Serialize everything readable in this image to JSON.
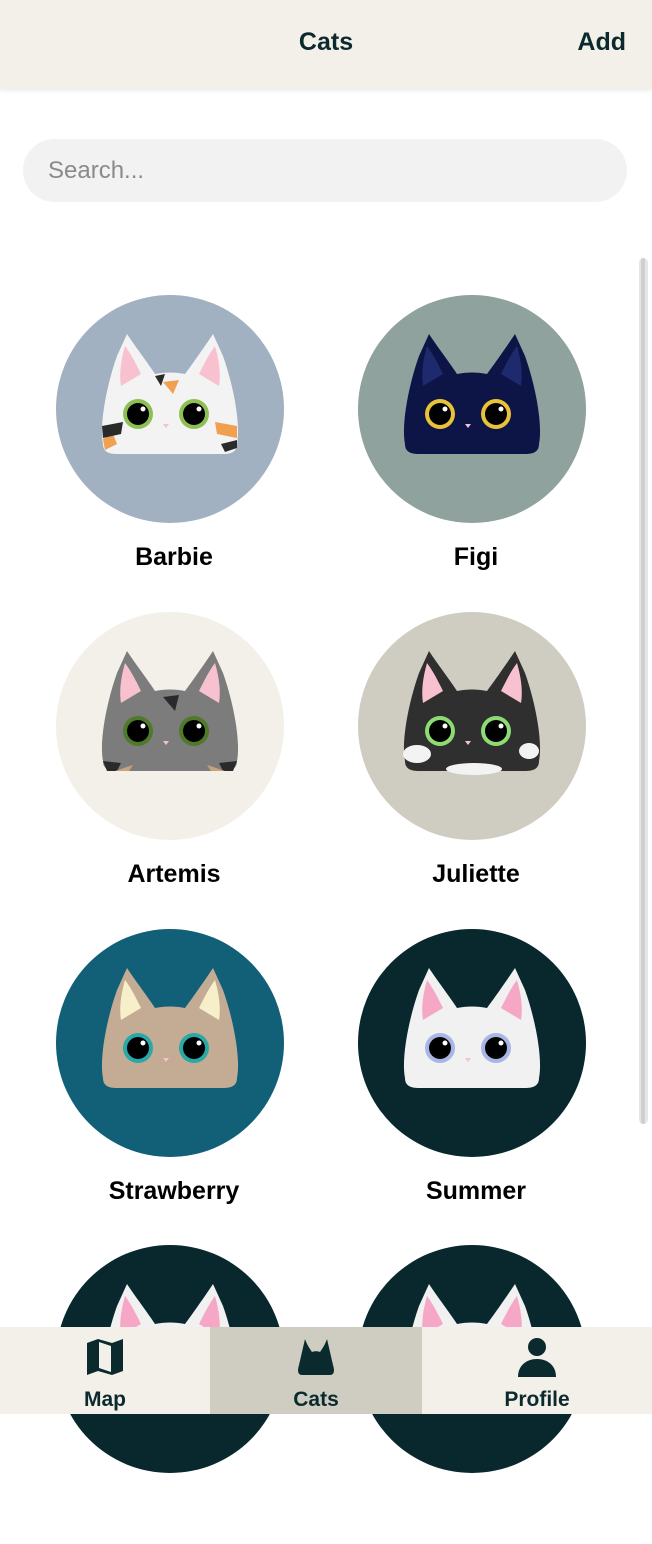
{
  "header": {
    "title": "Cats",
    "add_label": "Add"
  },
  "search": {
    "placeholder": "Search..."
  },
  "cats": [
    {
      "name": "Barbie",
      "background": "#a1b1c1",
      "fur": "#f3f3f3",
      "ear_inner": "#f7c1d0",
      "eye": "#8dbf55",
      "pattern": "calico"
    },
    {
      "name": "Figi",
      "background": "#8fa29e",
      "fur": "#0d1547",
      "ear_inner": "#1e2a6e",
      "eye": "#e9c23a",
      "pattern": "solid"
    },
    {
      "name": "Artemis",
      "background": "#f3f0e9",
      "fur": "#7c7c7c",
      "ear_inner": "#f7c1d0",
      "eye": "#4f7a2a",
      "pattern": "tabby"
    },
    {
      "name": "Juliette",
      "background": "#cfcdc2",
      "fur": "#2f2f2f",
      "ear_inner": "#f7c1d0",
      "eye": "#8edb73",
      "pattern": "tuxedo"
    },
    {
      "name": "Strawberry",
      "background": "#126078",
      "fur": "#c4ab93",
      "ear_inner": "#f7efc9",
      "eye": "#2aa8a8",
      "pattern": "solid"
    },
    {
      "name": "Summer",
      "background": "#08282e",
      "fur": "#f1f1f1",
      "ear_inner": "#f7a7c6",
      "eye": "#a9b5e4",
      "pattern": "solid"
    },
    {
      "name": "",
      "background": "#08282e",
      "fur": "#f1f1f1",
      "ear_inner": "#f7a7c6",
      "eye": "#a9b5e4",
      "pattern": "solid"
    },
    {
      "name": "",
      "background": "#08282e",
      "fur": "#f1f1f1",
      "ear_inner": "#f7a7c6",
      "eye": "#a9b5e4",
      "pattern": "solid"
    }
  ],
  "tabs": [
    {
      "label": "Map",
      "icon": "map-icon",
      "active": false
    },
    {
      "label": "Cats",
      "icon": "cat-icon",
      "active": true
    },
    {
      "label": "Profile",
      "icon": "profile-icon",
      "active": false
    }
  ],
  "colors": {
    "accent": "#0b2a2e",
    "header_bg": "#f3f0e9",
    "active_tab_bg": "#cfcdc2"
  }
}
